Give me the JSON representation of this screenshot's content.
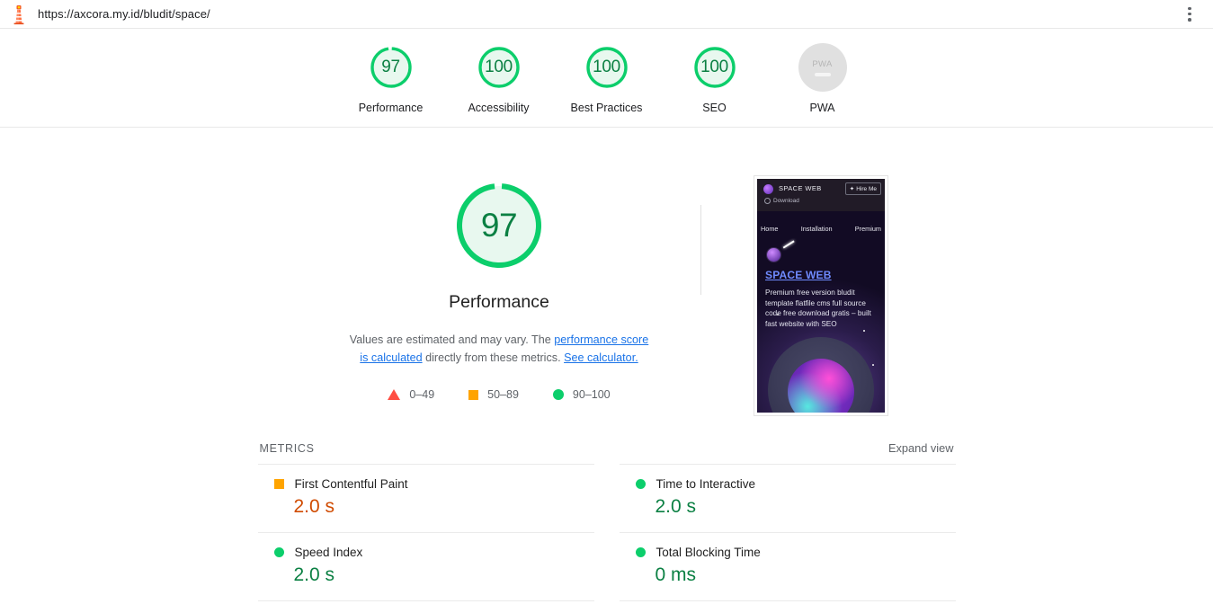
{
  "browser": {
    "url": "https://axcora.my.id/bludit/space/",
    "lighthouse_icon": "lighthouse-icon",
    "menu_icon": "kebab-menu-icon"
  },
  "colors": {
    "pass": "#0cce6b",
    "average": "#ffa400",
    "fail": "#ff4e42",
    "pass_text": "#0b8043",
    "average_text": "#d04b00",
    "link": "#1a73e8",
    "null_gray": "#e0e0e0"
  },
  "score_strip": {
    "categories": [
      {
        "label": "Performance",
        "score": "97",
        "value": 97,
        "state": "pass"
      },
      {
        "label": "Accessibility",
        "score": "100",
        "value": 100,
        "state": "pass"
      },
      {
        "label": "Best Practices",
        "score": "100",
        "value": 100,
        "state": "pass"
      },
      {
        "label": "SEO",
        "score": "100",
        "value": 100,
        "state": "pass"
      },
      {
        "label": "PWA",
        "score": "PWA",
        "value": null,
        "state": "null"
      }
    ]
  },
  "hero": {
    "gauge_score": "97",
    "gauge_value": 97,
    "title": "Performance",
    "desc_part1": "Values are estimated and may vary. The ",
    "desc_link1": "performance score is calculated",
    "desc_part2": " directly from these metrics. ",
    "desc_link2": "See calculator.",
    "legend": [
      {
        "marker": "triangle-marker",
        "label": "0–49"
      },
      {
        "marker": "square-marker",
        "label": "50–89"
      },
      {
        "marker": "circle-marker",
        "label": "90–100"
      }
    ]
  },
  "thumbnail": {
    "alt": "final-screenshot",
    "brand": "SPACE WEB",
    "hire_button": "Hire Me",
    "download_link": "Download",
    "nav": [
      "Home",
      "Installation",
      "Premium"
    ],
    "heading": "SPACE WEB",
    "paragraph": "Premium free version bludit template flatfile cms full source code free download gratis – built fast website with SEO"
  },
  "metrics": {
    "title": "METRICS",
    "expand_view": "Expand view",
    "left_column": [
      {
        "marker": "square-marker",
        "state": "average",
        "name": "First Contentful Paint",
        "value": "2.0 s"
      },
      {
        "marker": "circle-marker",
        "state": "pass",
        "name": "Speed Index",
        "value": "2.0 s"
      }
    ],
    "right_column": [
      {
        "marker": "circle-marker",
        "state": "pass",
        "name": "Time to Interactive",
        "value": "2.0 s"
      },
      {
        "marker": "circle-marker",
        "state": "pass",
        "name": "Total Blocking Time",
        "value": "0 ms"
      }
    ]
  }
}
